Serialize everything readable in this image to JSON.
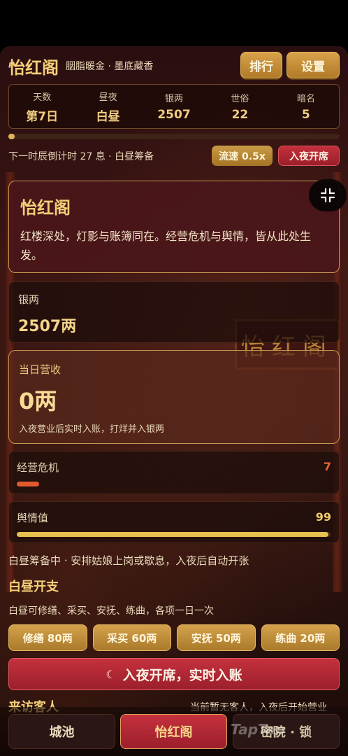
{
  "header": {
    "title": "怡红阁",
    "subtitle": "胭脂暖金 · 墨底藏香",
    "rank_label": "排行",
    "settings_label": "设置"
  },
  "stats": [
    {
      "label": "天数",
      "value": "第7日"
    },
    {
      "label": "昼夜",
      "value": "白昼"
    },
    {
      "label": "银两",
      "value": "2507"
    },
    {
      "label": "世俗",
      "value": "22"
    },
    {
      "label": "暗名",
      "value": "5"
    }
  ],
  "day_progress": 0.02,
  "timer": {
    "text": "下一时辰倒计时 27 息 · 白昼筹备",
    "speed_label": "流速 0.5x",
    "night_label": "入夜开席"
  },
  "intro": {
    "title": "怡红阁",
    "text": "红楼深处，灯影与账簿同在。经营危机与舆情，皆从此处生发。"
  },
  "background": {
    "plaque_text": "怡红阁"
  },
  "silver": {
    "label": "银两",
    "value": "2507两"
  },
  "revenue": {
    "label": "当日营收",
    "value": "0两",
    "note": "入夜营业后实时入账，打烊并入银两"
  },
  "crisis": {
    "label": "经营危机",
    "value": "7",
    "level": 7
  },
  "opinion": {
    "label": "舆情值",
    "value": "99",
    "level": 99
  },
  "day_prep": {
    "status": "白昼筹备中 · 安排姑娘上岗或歇息，入夜后自动开张",
    "section_title": "白昼开支",
    "section_note": "白昼可修缮、采买、安抚、练曲，各项一日一次",
    "actions": [
      {
        "label": "修缮 80两"
      },
      {
        "label": "采买 60两"
      },
      {
        "label": "安抚 50两"
      },
      {
        "label": "练曲 20两"
      }
    ],
    "night_button": "入夜开席，实时入账"
  },
  "guests": {
    "title": "来访客人",
    "note": "当前暂无客人，入夜后开始营业"
  },
  "tabs": [
    {
      "label": "城池"
    },
    {
      "label": "怡红阁"
    },
    {
      "label": "密院 · 锁"
    }
  ],
  "watermark": "TapTap",
  "colors": {
    "accent_gold": "#f4cf78",
    "button_gold": "#c99a46",
    "button_red": "#b02834",
    "crisis": "#e25a2e",
    "opinion": "#e8c04e"
  }
}
